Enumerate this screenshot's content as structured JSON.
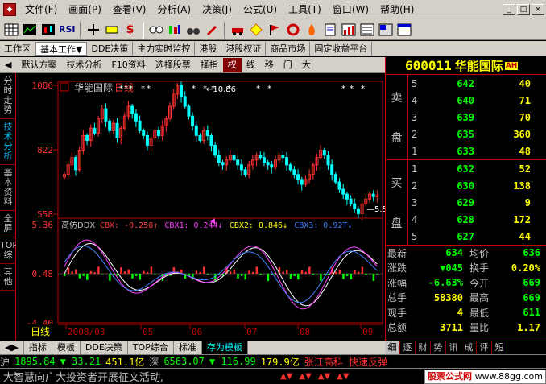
{
  "menu": {
    "items": [
      "文件(F)",
      "画面(P)",
      "查看(V)",
      "分析(A)",
      "决策(J)",
      "公式(U)",
      "工具(T)",
      "窗口(W)",
      "帮助(H)"
    ],
    "win_min": "_",
    "win_max": "□",
    "win_close": "×"
  },
  "toolbar": {
    "rsi_label": "RSI"
  },
  "tabs": [
    "工作区",
    "基本工作▼",
    "DDE决策",
    "主力实时监控",
    "港股",
    "港股权证",
    "商品市场",
    "固定收益平台"
  ],
  "subbar": {
    "items": [
      "默认方案",
      "技术分析",
      "F10资料",
      "选择股票",
      "择指",
      "权",
      "线",
      "移",
      "门",
      "大"
    ],
    "active_index": 5
  },
  "sidetabs": [
    "分时走势",
    "技术分析",
    "基本资料",
    "全屏",
    "TOP综",
    "其他"
  ],
  "sidetab_active": 1,
  "quote": {
    "code": "600011",
    "name": "华能国际",
    "badge": "AH",
    "sell_label": [
      "卖",
      "盘"
    ],
    "buy_label": [
      "买",
      "盘"
    ],
    "asks": [
      {
        "lvl": "5",
        "px": "642",
        "vol": "40"
      },
      {
        "lvl": "4",
        "px": "640",
        "vol": "71"
      },
      {
        "lvl": "3",
        "px": "639",
        "vol": "70"
      },
      {
        "lvl": "2",
        "px": "635",
        "vol": "360"
      },
      {
        "lvl": "1",
        "px": "633",
        "vol": "48"
      }
    ],
    "bids": [
      {
        "lvl": "1",
        "px": "632",
        "vol": "52"
      },
      {
        "lvl": "2",
        "px": "630",
        "vol": "138"
      },
      {
        "lvl": "3",
        "px": "629",
        "vol": "9"
      },
      {
        "lvl": "4",
        "px": "628",
        "vol": "172"
      },
      {
        "lvl": "5",
        "px": "627",
        "vol": "44"
      }
    ],
    "stats": [
      {
        "k": "最新",
        "v": "634",
        "vc": "#00ff00",
        "k2": "均价",
        "v2": "636",
        "v2c": "#00ff00"
      },
      {
        "k": "涨跌",
        "v": "▼045",
        "vc": "#00ff00",
        "k2": "换手",
        "v2": "0.20%",
        "v2c": "#ffff00"
      },
      {
        "k": "涨幅",
        "v": "-6.63%",
        "vc": "#00ff00",
        "k2": "今开",
        "v2": "669",
        "v2c": "#00ff00"
      },
      {
        "k": "总手",
        "v": "58380",
        "vc": "#ffff00",
        "k2": "最高",
        "v2": "669",
        "v2c": "#00ff00"
      },
      {
        "k": "现手",
        "v": "4",
        "vc": "#ffff00",
        "k2": "最低",
        "v2": "611",
        "v2c": "#00ff00"
      },
      {
        "k": "总额",
        "v": "3711",
        "vc": "#ffff00",
        "k2": "量比",
        "v2": "1.17",
        "v2c": "#ffff00"
      }
    ]
  },
  "right_tabs": [
    "细",
    "逐",
    "财",
    "势",
    "讯",
    "成",
    "评",
    "短"
  ],
  "bottom_tabs": [
    "指标",
    "模板",
    "DDE决策",
    "TOP综合",
    "标准",
    "存为模板"
  ],
  "ticker": {
    "sh_label": "沪",
    "sh_index": "1895.84",
    "sh_change": "▼ 33.21",
    "sh_amount": "451.1亿",
    "sz_label": "深",
    "sz_index": "6563.07",
    "sz_change": "▼ 116.99",
    "sz_amount": "179.9亿",
    "alert": "张江高科 快速反弹"
  },
  "news": {
    "text": "大智慧向广大投资者开展征文活动,",
    "ad_prefix": "股票公式网",
    "ad_url": "www.88gg.com"
  },
  "chart_data": [
    {
      "type": "candlestick",
      "title": "华能国际",
      "period": "日线",
      "y_axis_labels": [
        "1086",
        "822",
        "558"
      ],
      "ylim": [
        558,
        1086
      ],
      "x_axis_labels": [
        "2008/03",
        "05",
        "06",
        "07",
        "08",
        "09"
      ],
      "annotations": [
        "10.86",
        "5.58"
      ],
      "series_close": [
        720,
        760,
        790,
        740,
        820,
        880,
        860,
        910,
        890,
        950,
        990,
        940,
        900,
        930,
        870,
        910,
        960,
        1000,
        970,
        940,
        900,
        880,
        840,
        870,
        900,
        880,
        920,
        950,
        1000,
        1050,
        1086,
        1040,
        1000,
        960,
        920,
        880,
        860,
        900,
        880,
        840,
        800,
        770,
        760,
        780,
        800,
        780,
        760,
        740,
        720,
        760,
        780,
        800,
        790,
        770,
        760,
        750,
        780,
        800,
        790,
        760,
        740,
        720,
        700,
        680,
        700,
        720,
        760,
        790,
        820,
        800,
        760,
        720,
        690,
        660,
        640,
        620,
        600,
        580,
        560,
        600,
        620,
        640,
        630,
        634
      ]
    },
    {
      "type": "line",
      "title": "高仿DDX",
      "y_axis_labels": [
        "5.36",
        "0.48",
        "-4.40"
      ],
      "ylim": [
        -4.4,
        5.36
      ],
      "legend": [
        {
          "name": "CBX",
          "value": "-0.258",
          "arrow": "↑",
          "color": "#ff4040"
        },
        {
          "name": "CBX1",
          "value": "0.244",
          "arrow": "↓",
          "color": "#ff40ff"
        },
        {
          "name": "CBX2",
          "value": "0.846",
          "arrow": "↓",
          "color": "#ffff00"
        },
        {
          "name": "CBX3",
          "value": "0.92T",
          "arrow": "↓",
          "color": "#4080ff"
        }
      ]
    }
  ]
}
